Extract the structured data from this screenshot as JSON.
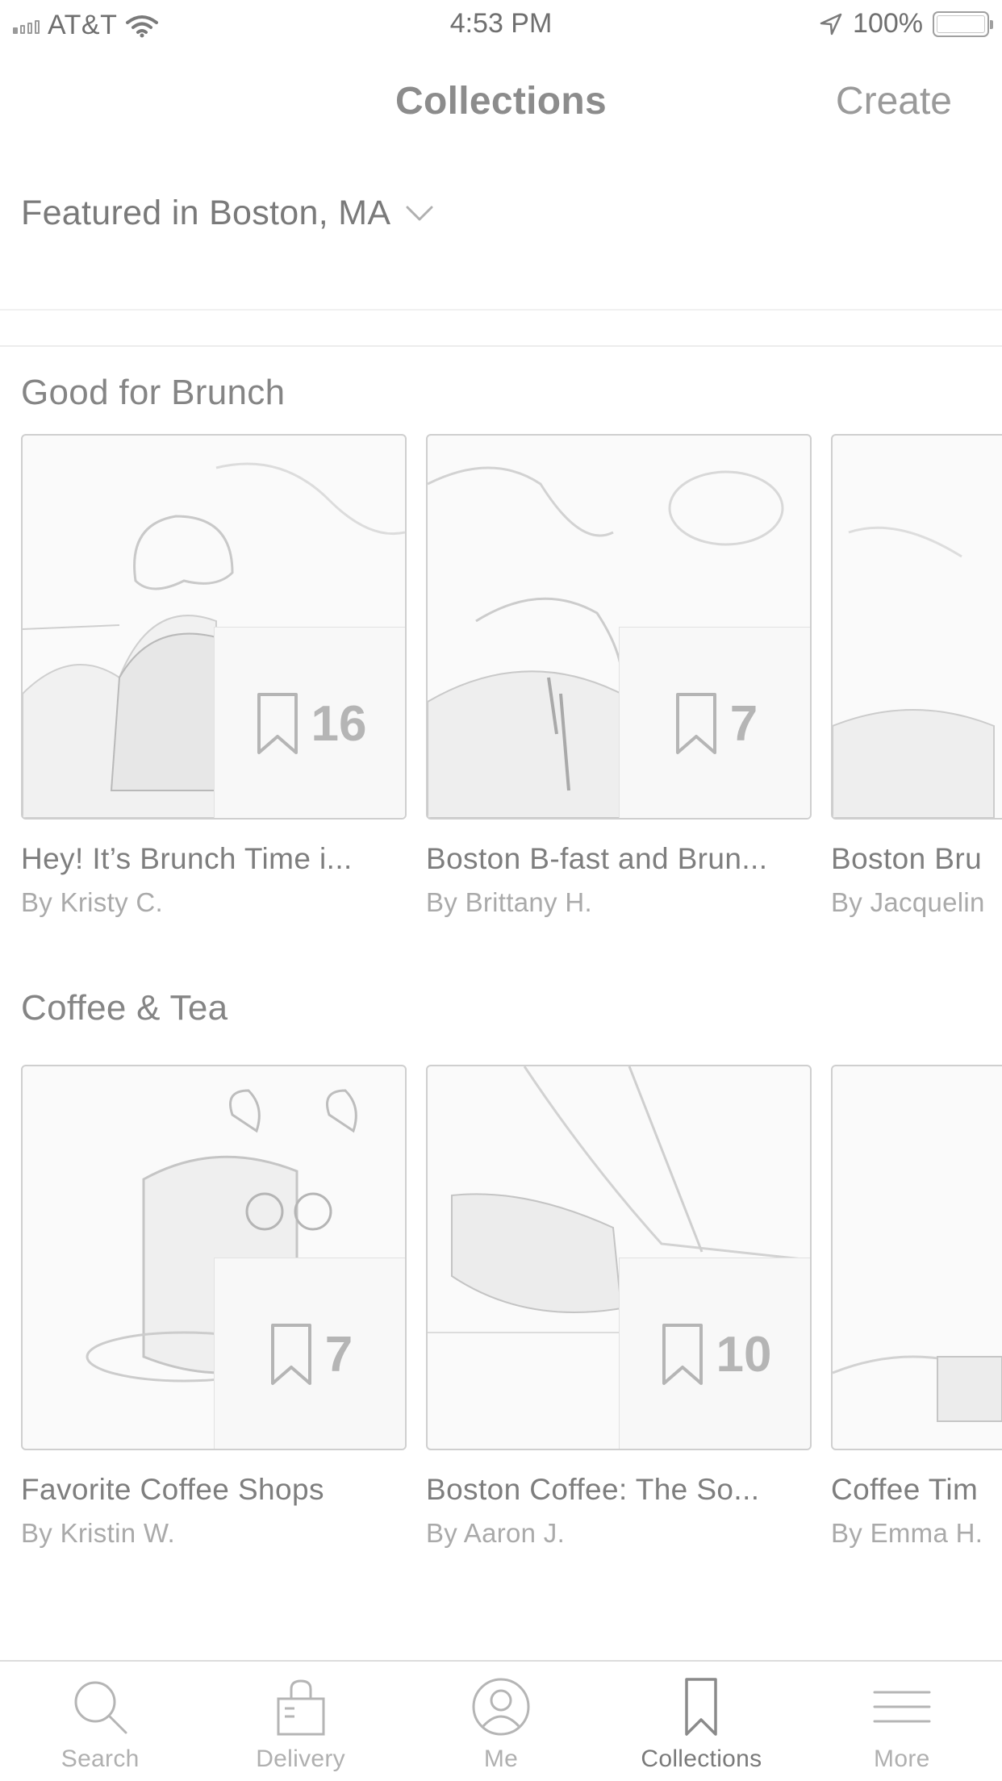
{
  "status_bar": {
    "carrier": "AT&T",
    "time": "4:53 PM",
    "battery": "100%"
  },
  "nav": {
    "title": "Collections",
    "create": "Create"
  },
  "featured": {
    "label": "Featured in Boston, MA"
  },
  "sections": [
    {
      "title": "Good for Brunch",
      "cards": [
        {
          "title": "Hey! It’s Brunch Time i...",
          "author": "By Kristy C.",
          "count": "16"
        },
        {
          "title": "Boston B-fast and Brun...",
          "author": "By Brittany H.",
          "count": "7"
        },
        {
          "title": "Boston Bru",
          "author": "By Jacquelin",
          "count": ""
        }
      ]
    },
    {
      "title": "Coffee & Tea",
      "cards": [
        {
          "title": "Favorite Coffee Shops",
          "author": "By Kristin W.",
          "count": "7"
        },
        {
          "title": "Boston Coffee: The So...",
          "author": "By Aaron J.",
          "count": "10"
        },
        {
          "title": "Coffee Tim",
          "author": "By Emma H.",
          "count": ""
        }
      ]
    }
  ],
  "tabbar": {
    "items": [
      {
        "label": "Search",
        "icon": "search-icon"
      },
      {
        "label": "Delivery",
        "icon": "delivery-bag-icon"
      },
      {
        "label": "Me",
        "icon": "profile-icon"
      },
      {
        "label": "Collections",
        "icon": "bookmark-icon",
        "active": true
      },
      {
        "label": "More",
        "icon": "menu-icon"
      }
    ]
  }
}
